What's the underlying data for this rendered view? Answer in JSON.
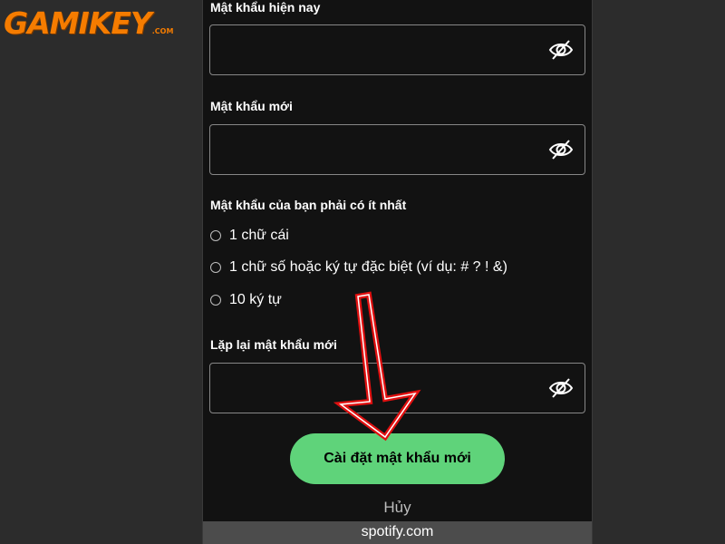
{
  "brand": {
    "logo_text": "GAMIKEY",
    "logo_suffix": ".COM"
  },
  "form": {
    "current_password": {
      "label": "Mật khẩu hiện nay",
      "value": "",
      "toggle_icon": "eye-slash-icon"
    },
    "new_password": {
      "label": "Mật khẩu mới",
      "value": "",
      "toggle_icon": "eye-slash-icon"
    },
    "requirements": {
      "heading": "Mật khẩu của bạn phải có ít nhất",
      "items": [
        "1 chữ cái",
        "1 chữ số hoặc ký tự đặc biệt (ví dụ: # ? ! &)",
        "10 ký tự"
      ]
    },
    "repeat_password": {
      "label": "Lặp lại mật khẩu mới",
      "value": "",
      "toggle_icon": "eye-slash-icon"
    },
    "submit_label": "Cài đặt mật khẩu mới",
    "cancel_label": "Hủy"
  },
  "browser": {
    "domain": "spotify.com"
  },
  "colors": {
    "page_background": "#2c2c2c",
    "app_background": "#121212",
    "accent_green": "#5fd37a",
    "field_border": "#878787",
    "annotation_red": "#e01010",
    "brand_orange": "#f57c00",
    "url_bar": "#4c4c4c"
  }
}
